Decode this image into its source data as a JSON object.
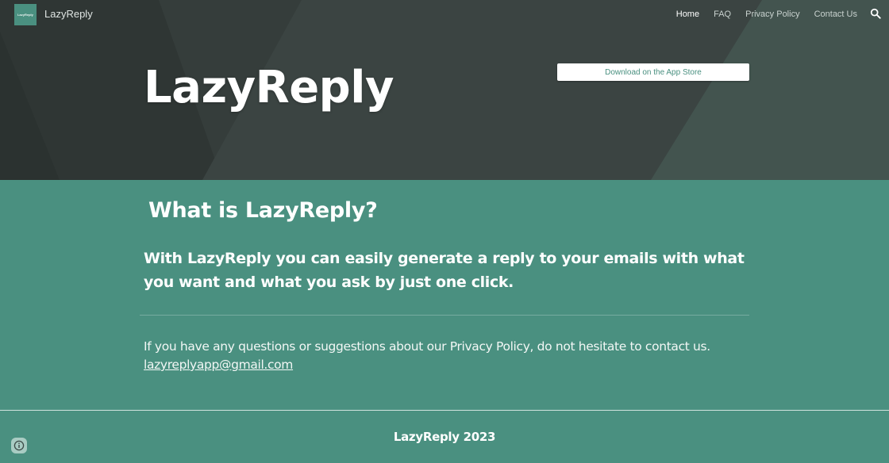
{
  "header": {
    "logo_text": "LazyReply",
    "site_name": "LazyReply",
    "nav": [
      {
        "label": "Home",
        "active": true
      },
      {
        "label": "FAQ",
        "active": false
      },
      {
        "label": "Privacy Policy",
        "active": false
      },
      {
        "label": "Contact Us",
        "active": false
      }
    ],
    "search_icon": "search-icon"
  },
  "hero": {
    "title": "LazyReply",
    "app_store_button": "Download on the App Store"
  },
  "main": {
    "heading": "What is LazyReply?",
    "lead": "With LazyReply you can easily generate a reply to your emails with what you want and what you ask by just one click.",
    "note": "If you have any questions or suggestions about our Privacy Policy, do not hesitate to contact us.",
    "email": "lazyreplyapp@gmail.com"
  },
  "footer": {
    "text": "LazyReply 2023",
    "info_icon": "info-icon"
  },
  "colors": {
    "accent": "#4a9080",
    "hero_dark": "#363e3c",
    "white": "#ffffff"
  }
}
